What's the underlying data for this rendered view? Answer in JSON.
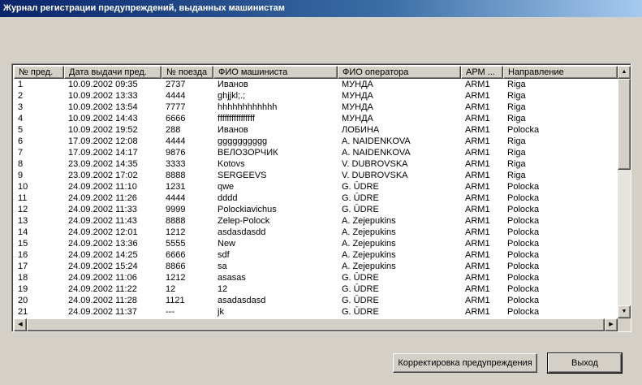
{
  "window": {
    "title": "Журнал регистрации предупреждений, выданных машинистам"
  },
  "table": {
    "columns": [
      "№ пред.",
      "Дата выдачи пред.",
      "№ поезда",
      "ФИО машиниста",
      "ФИО оператора",
      "АРМ ...",
      "Направление"
    ],
    "rows": [
      [
        "1",
        "10.09.2002 09:35",
        "2737",
        "Иванов",
        "МУНДА",
        "ARM1",
        "Riga"
      ],
      [
        "2",
        "10.09.2002 13:33",
        "4444",
        "ghjjkl;.;",
        "МУНДА",
        "ARM1",
        "Riga"
      ],
      [
        "3",
        "10.09.2002 13:54",
        "7777",
        "hhhhhhhhhhhh",
        "МУНДА",
        "ARM1",
        "Riga"
      ],
      [
        "4",
        "10.09.2002 14:43",
        "6666",
        "ffffffffffffffff",
        "МУНДА",
        "ARM1",
        "Riga"
      ],
      [
        "5",
        "10.09.2002 19:52",
        "288",
        "Иванов",
        "ЛОБИНА",
        "ARM1",
        "Polocka"
      ],
      [
        "6",
        "17.09.2002 12:08",
        "4444",
        "gggggggggg",
        "A. NAIDENKOVA",
        "ARM1",
        "Riga"
      ],
      [
        "7",
        "17.09.2002 14:17",
        "9876",
        "ВЕЛОЗОРЧИК",
        "A. NAIDENKOVA",
        "ARM1",
        "Riga"
      ],
      [
        "8",
        "23.09.2002 14:35",
        "3333",
        "Kotovs",
        "V. DUBROVSKA",
        "ARM1",
        "Riga"
      ],
      [
        "9",
        "23.09.2002 17:02",
        "8888",
        "SERGEEVS",
        "V. DUBROVSKA",
        "ARM1",
        "Riga"
      ],
      [
        "10",
        "24.09.2002 11:10",
        "1231",
        "qwe",
        "G. ŪDRE",
        "ARM1",
        "Polocka"
      ],
      [
        "11",
        "24.09.2002 11:26",
        "4444",
        "dddd",
        "G. ŪDRE",
        "ARM1",
        "Polocka"
      ],
      [
        "12",
        "24.09.2002 11:33",
        "9999",
        "Polockiavichus",
        "G. ŪDRE",
        "ARM1",
        "Polocka"
      ],
      [
        "13",
        "24.09.2002 11:43",
        "8888",
        "Zelep-Polock",
        "A. Zejepukins",
        "ARM1",
        "Polocka"
      ],
      [
        "14",
        "24.09.2002 12:01",
        "1212",
        "asdasdasdd",
        "A. Zejepukins",
        "ARM1",
        "Polocka"
      ],
      [
        "15",
        "24.09.2002 13:36",
        "5555",
        "New",
        "A. Zejepukins",
        "ARM1",
        "Polocka"
      ],
      [
        "16",
        "24.09.2002 14:25",
        "6666",
        "sdf",
        "A. Zejepukins",
        "ARM1",
        "Polocka"
      ],
      [
        "17",
        "24.09.2002 15:24",
        "8866",
        "sa",
        "A. Zejepukins",
        "ARM1",
        "Polocka"
      ],
      [
        "18",
        "24.09.2002 11:06",
        "1212",
        "asasas",
        "G. ŪDRE",
        "ARM1",
        "Polocka"
      ],
      [
        "19",
        "24.09.2002 11:22",
        "12",
        "12",
        "G. ŪDRE",
        "ARM1",
        "Polocka"
      ],
      [
        "20",
        "24.09.2002 11:28",
        "1121",
        "asadasdasd",
        "G. ŪDRE",
        "ARM1",
        "Polocka"
      ],
      [
        "21",
        "24.09.2002 11:37",
        "---",
        "jk",
        "G. ŪDRE",
        "ARM1",
        "Polocka"
      ]
    ]
  },
  "scrollbars": {
    "up": "▲",
    "down": "▼",
    "left": "◀",
    "right": "▶"
  },
  "buttons": {
    "edit": "Корректировка предупреждения",
    "exit": "Выход"
  }
}
